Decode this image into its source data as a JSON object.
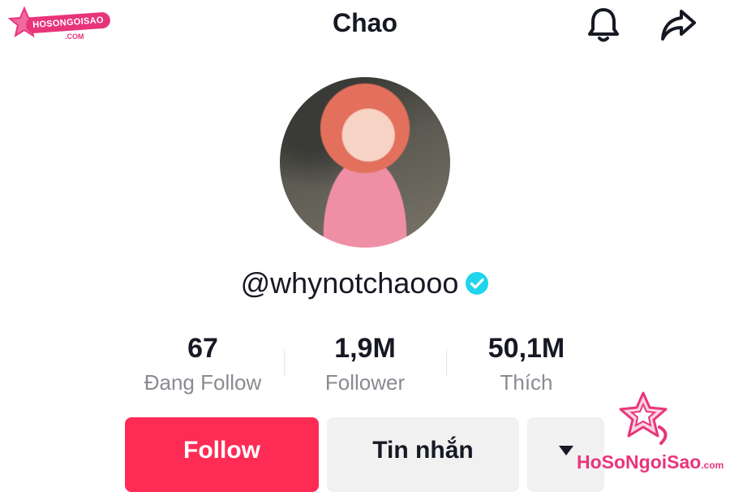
{
  "watermark_top": {
    "brand": "HOSONGOISAO",
    "suffix": ".COM"
  },
  "header": {
    "title": "Chao",
    "bell_icon": "bell-icon",
    "share_icon": "share-icon"
  },
  "profile": {
    "username": "@whynotchaooo",
    "verified_icon": "verified-badge-icon"
  },
  "stats": [
    {
      "value": "67",
      "label": "Đang Follow"
    },
    {
      "value": "1,9M",
      "label": "Follower"
    },
    {
      "value": "50,1M",
      "label": "Thích"
    }
  ],
  "actions": {
    "follow": "Follow",
    "message": "Tin nhắn",
    "more_icon": "caret-down-icon"
  },
  "watermark_bottom": {
    "brand": "HoSoNgoiSao",
    "suffix": ".com"
  },
  "colors": {
    "accent": "#fe2c55",
    "verified": "#20d5ec",
    "watermark": "#e8357a",
    "muted": "#8a8b91"
  }
}
